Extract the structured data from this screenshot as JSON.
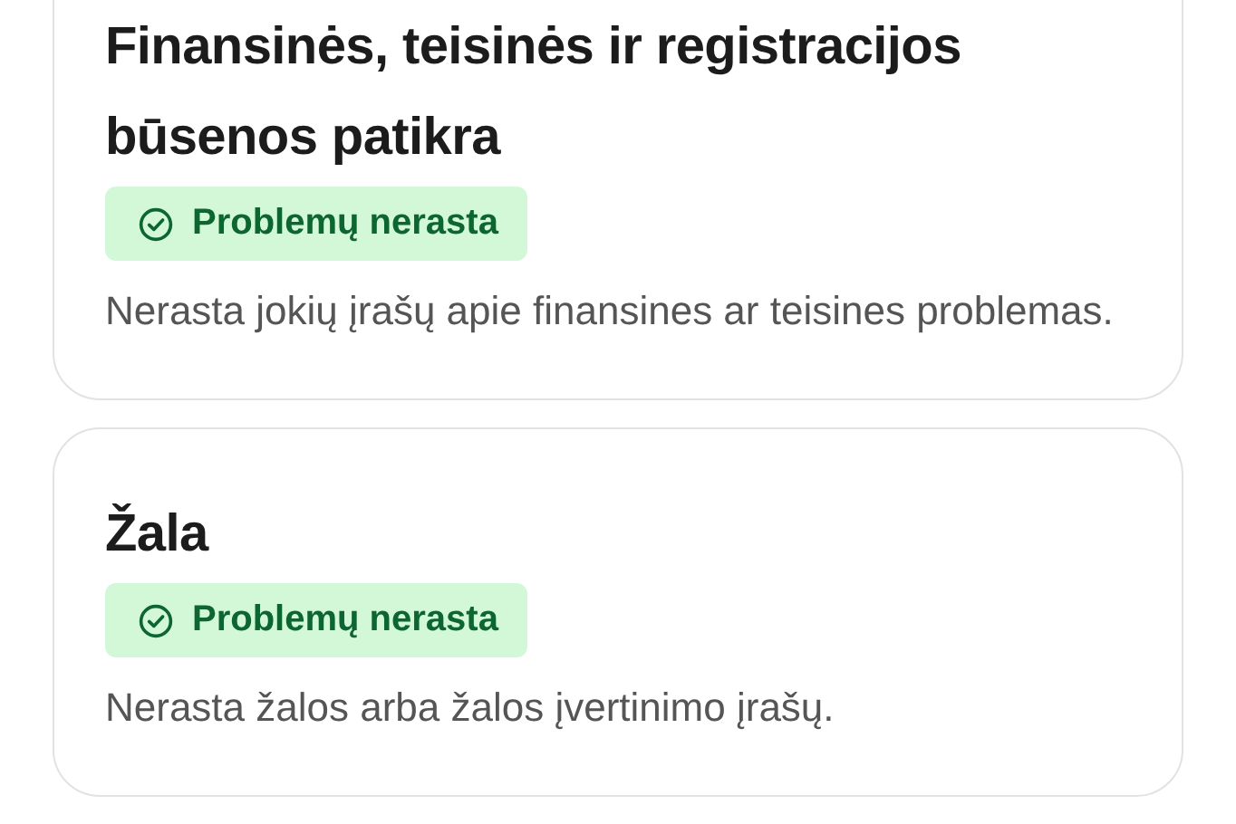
{
  "checks": [
    {
      "title": "Finansinės, teisinės ir registracijos būsenos patikra",
      "status": {
        "kind": "ok",
        "label": "Problemų nerasta"
      },
      "description": "Nerasta jokių įrašų apie finansines ar teisines problemas."
    },
    {
      "title": "Žala",
      "status": {
        "kind": "ok",
        "label": "Problemų nerasta"
      },
      "description": "Nerasta žalos arba žalos įvertinimo įrašų."
    }
  ]
}
